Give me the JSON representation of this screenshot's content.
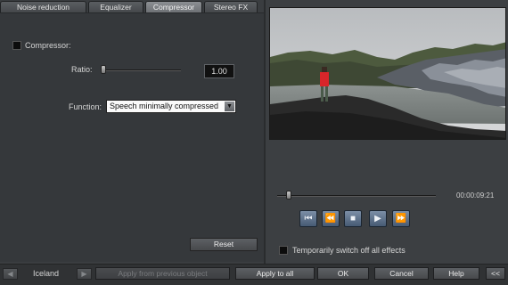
{
  "tabs": [
    {
      "label": "Noise reduction"
    },
    {
      "label": "Equalizer"
    },
    {
      "label": "Compressor"
    },
    {
      "label": "Stereo FX"
    }
  ],
  "compressor": {
    "checkbox_label": "Compressor:",
    "checked": false,
    "ratio_label": "Ratio:",
    "ratio_value": "1.00",
    "ratio_slider_level": 0.0,
    "function_label": "Function:",
    "function_value": "Speech minimally compressed",
    "reset_label": "Reset"
  },
  "player": {
    "position_fraction": 0.06,
    "timecode": "00:00:09:21",
    "transport": [
      "skip-to-start-icon",
      "rewind-icon",
      "stop-icon",
      "play-icon",
      "fast-forward-icon"
    ],
    "transport_glyphs": [
      "⏮",
      "⏪",
      "■",
      "▶",
      "⏩"
    ],
    "bypass_label": "Temporarily switch off all effects"
  },
  "bottom": {
    "object_name": "Iceland",
    "apply_previous_label": "Apply from previous object",
    "apply_all_label": "Apply to all",
    "ok_label": "OK",
    "cancel_label": "Cancel",
    "help_label": "Help",
    "collapse_label": "<<"
  },
  "colors": {
    "accent_transport": "#5a6f89",
    "background": "#3a3d40"
  }
}
